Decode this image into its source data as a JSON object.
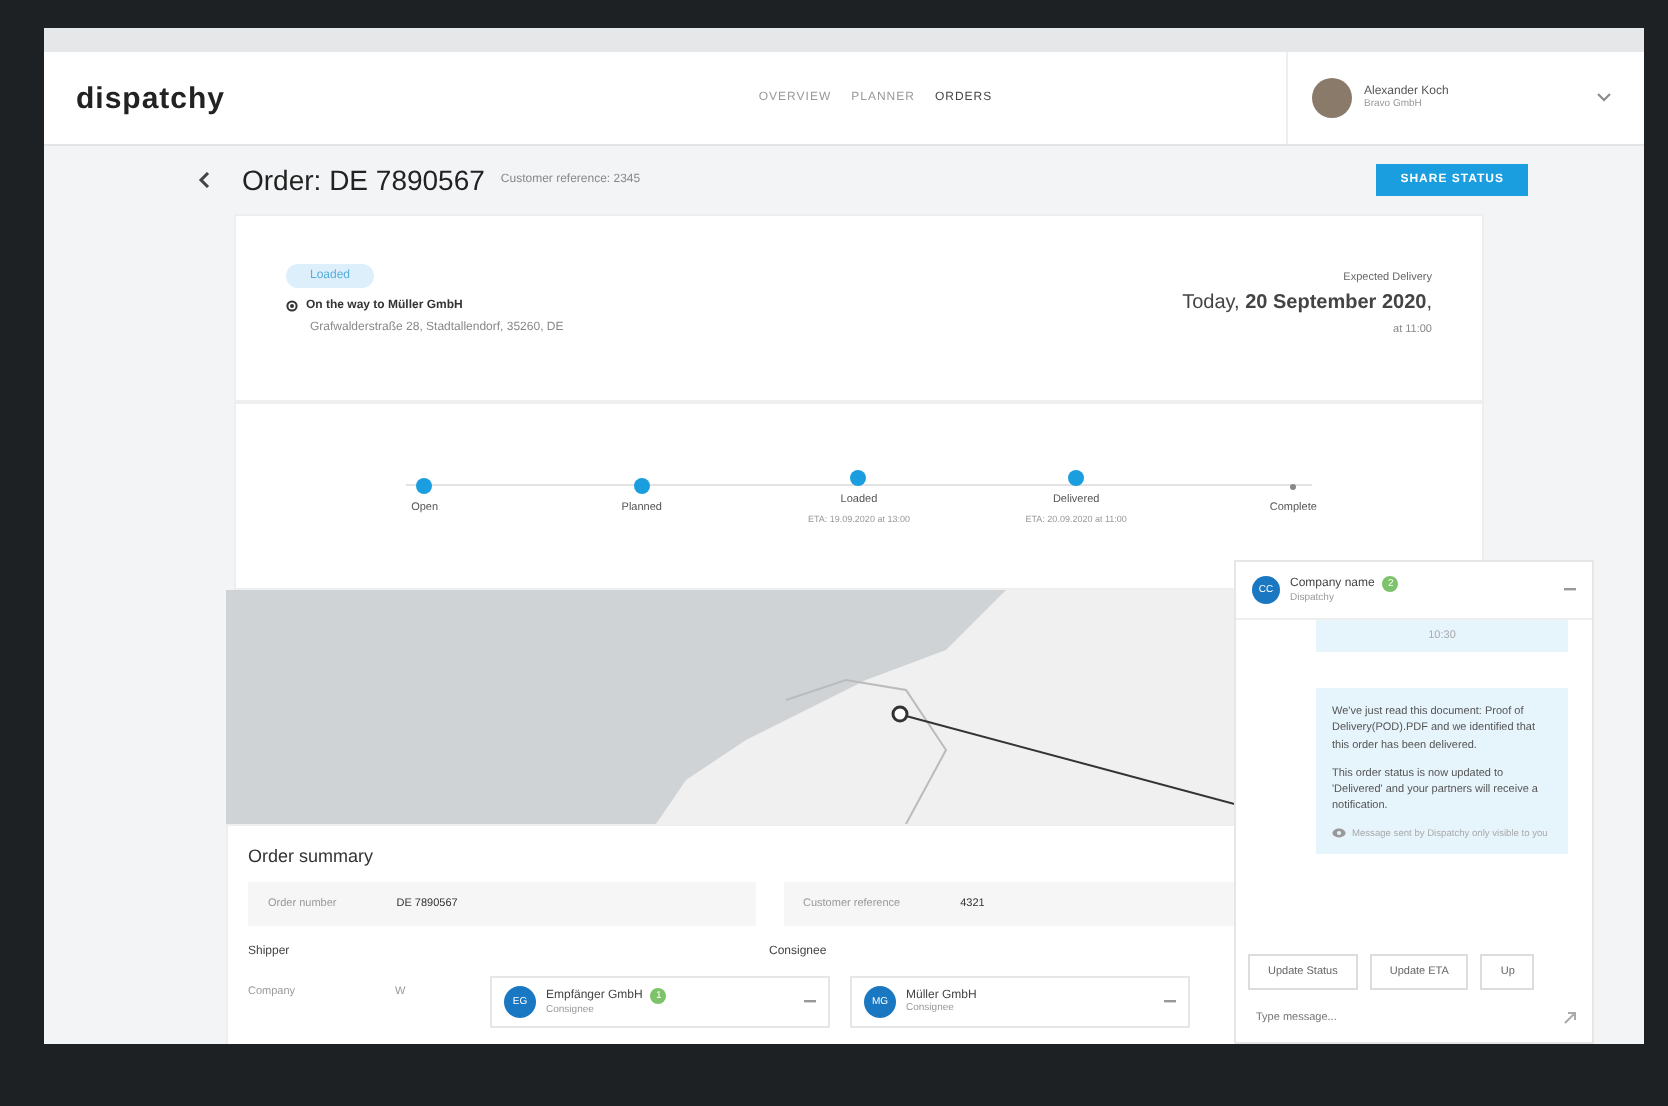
{
  "window": {
    "title": "dispatchy"
  },
  "nav": [
    {
      "label": "OVERVIEW",
      "selected": false
    },
    {
      "label": "PLANNER",
      "selected": false
    },
    {
      "label": "ORDERS",
      "selected": true
    }
  ],
  "user": {
    "name": "Alexander Koch",
    "company": "Bravo GmbH"
  },
  "order": {
    "title": "Order: DE 7890567",
    "reference": "Customer reference: 2345",
    "share_button": "SHARE STATUS"
  },
  "status": {
    "badge": "Loaded",
    "destination": "On the way to Müller GmbH",
    "address": "Grafwalderstraße 28, Stadtallendorf, 35260, DE",
    "expected_label": "Expected Delivery",
    "expected_date": "Today, **20 September 2020**,",
    "expected_time": "at 11:00"
  },
  "steps": [
    {
      "label": "Open",
      "done": true
    },
    {
      "label": "Planned",
      "done": true
    },
    {
      "label": "Loaded",
      "eta": "ETA: 19.09.2020 at 13:00",
      "done": true
    },
    {
      "label": "Delivered",
      "eta": "ETA: 20.09.2020 at 11:00",
      "done": true
    },
    {
      "label": "Complete",
      "done": false
    }
  ],
  "summary": {
    "title": "Order summary",
    "fields": [
      {
        "label": "Order number",
        "value": "DE 7890567"
      },
      {
        "label": "Customer reference",
        "value": "4321"
      }
    ],
    "shipper": "Shipper",
    "consignee": "Consignee",
    "company_label": "Company",
    "company_value": "W"
  },
  "chat": {
    "initials": "CC",
    "name": "Company name",
    "badge": "2",
    "subtitle": "Dispatchy",
    "time": "10:30",
    "message": [
      "We've just read this document: Proof of Delivery(POD).PDF and we identified that this order has been delivered.",
      "This order status is now updated to 'Delivered' and your partners will receive a notification."
    ],
    "note": "Message sent by Dispatchy only visible to you",
    "actions": [
      "Update Status",
      "Update ETA",
      "Up"
    ],
    "placeholder": "Type message..."
  },
  "chips": [
    {
      "initials": "EG",
      "name": "Empfänger GmbH",
      "role": "Consignee",
      "badge": "1"
    },
    {
      "initials": "MG",
      "name": "Müller GmbH",
      "role": "Consignee"
    }
  ]
}
